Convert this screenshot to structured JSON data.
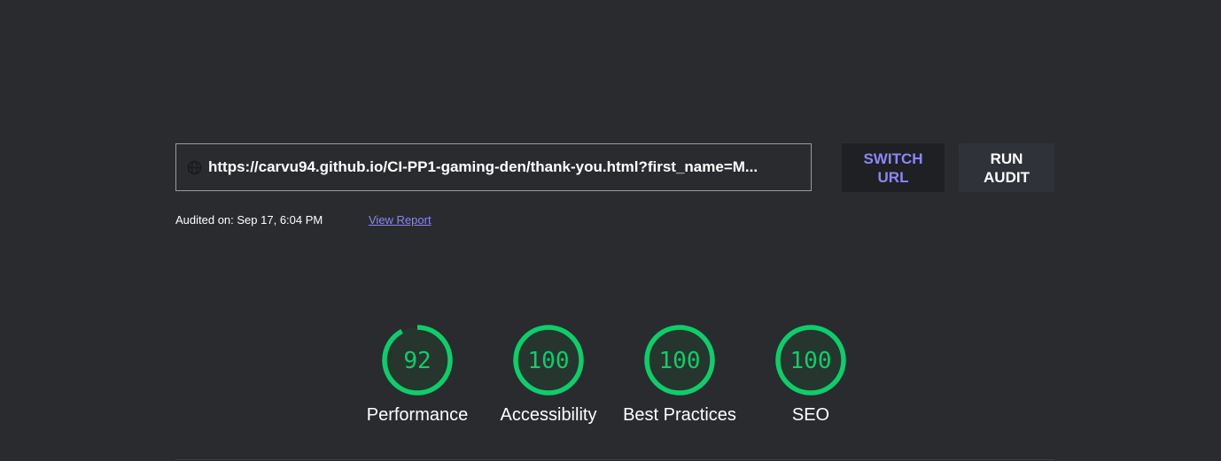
{
  "url_bar": {
    "value": "https://carvu94.github.io/CI-PP1-gaming-den/thank-you.html?first_name=M...",
    "icon": "globe-icon"
  },
  "buttons": {
    "switch_url": "SWITCH URL",
    "run_audit": "RUN AUDIT"
  },
  "meta": {
    "audited_on": "Audited on: Sep 17, 6:04 PM",
    "view_report": "View Report"
  },
  "colors": {
    "pass": "#0cce6b",
    "link": "#8b87f5",
    "background": "#2a2b2f"
  },
  "gauges": [
    {
      "label": "Performance",
      "score": "92",
      "value": 92
    },
    {
      "label": "Accessibility",
      "score": "100",
      "value": 100
    },
    {
      "label": "Best Practices",
      "score": "100",
      "value": 100
    },
    {
      "label": "SEO",
      "score": "100",
      "value": 100
    }
  ]
}
